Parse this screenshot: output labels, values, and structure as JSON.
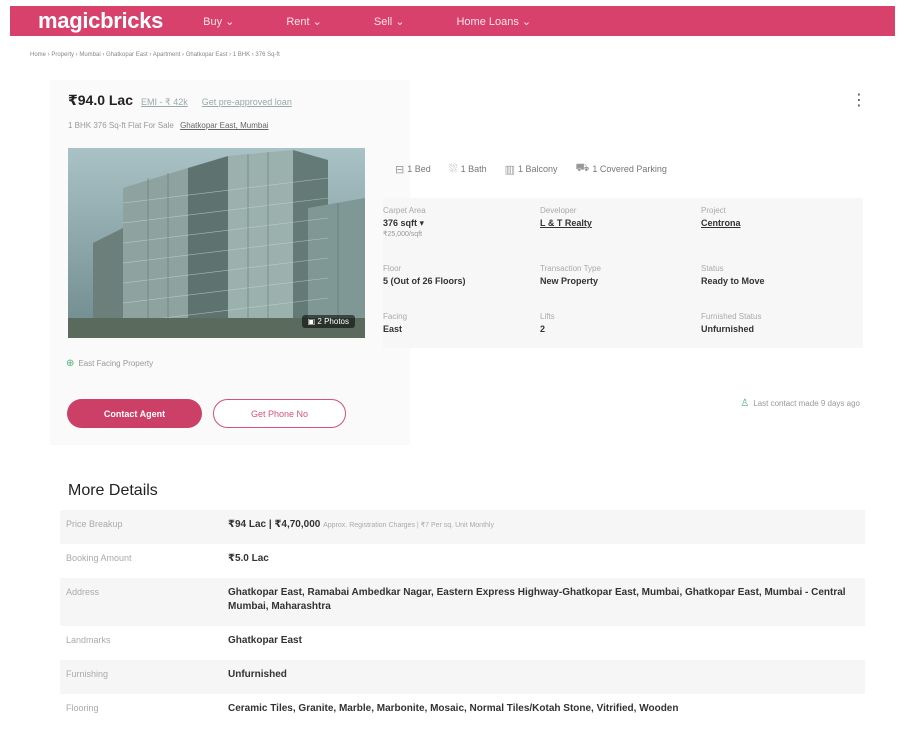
{
  "header": {
    "logo": "magicbricks",
    "nav": [
      "Buy ⌄",
      "Rent ⌄",
      "Sell ⌄",
      "Home Loans ⌄"
    ]
  },
  "breadcrumb": "Home › Property › Mumbai › Ghatkopar East › Apartment › Ghatkopar East › 1 BHK › 376 Sq-ft",
  "listing": {
    "price": "₹94.0 Lac",
    "emi": "EMI - ₹ 42k",
    "loan": "Get pre-approved loan",
    "subtitle": "1 BHK 376 Sq-ft Flat For Sale",
    "location": "Ghatkopar East, Mumbai",
    "photos_label": "2 Photos",
    "amenities": [
      "1 Bed",
      "1 Bath",
      "1 Balcony",
      "1 Covered Parking"
    ],
    "details": [
      {
        "label": "Carpet Area",
        "value": "376 sqft ▾",
        "sub": "₹25,000/sqft",
        "link": false
      },
      {
        "label": "Developer",
        "value": "L & T Realty",
        "sub": "",
        "link": true
      },
      {
        "label": "Project",
        "value": "Centrona",
        "sub": "",
        "link": true
      },
      {
        "label": "Floor",
        "value": "5 (Out of 26 Floors)",
        "sub": "",
        "link": false
      },
      {
        "label": "Transaction Type",
        "value": "New Property",
        "sub": "",
        "link": false
      },
      {
        "label": "Status",
        "value": "Ready to Move",
        "sub": "",
        "link": false
      },
      {
        "label": "Facing",
        "value": "East",
        "sub": "",
        "link": false
      },
      {
        "label": "Lifts",
        "value": "2",
        "sub": "",
        "link": false
      },
      {
        "label": "Furnished Status",
        "value": "Unfurnished",
        "sub": "",
        "link": false
      }
    ],
    "facing_note": "East Facing Property",
    "contact_button": "Contact Agent",
    "phone_button": "Get Phone No",
    "last_contact": "Last contact made 9 days ago"
  },
  "more_details": {
    "title": "More Details",
    "rows": [
      {
        "label": "Price Breakup",
        "value": "₹94 Lac | ₹4,70,000",
        "note": "Approx. Registration Charges | ₹7 Per sq. Unit Monthly"
      },
      {
        "label": "Booking Amount",
        "value": "₹5.0 Lac",
        "note": ""
      },
      {
        "label": "Address",
        "value": "Ghatkopar East, Ramabai Ambedkar Nagar, Eastern Express Highway-Ghatkopar East, Mumbai, Ghatkopar East, Mumbai - Central Mumbai, Maharashtra",
        "note": ""
      },
      {
        "label": "Landmarks",
        "value": "Ghatkopar East",
        "note": ""
      },
      {
        "label": "Furnishing",
        "value": "Unfurnished",
        "note": ""
      },
      {
        "label": "Flooring",
        "value": "Ceramic Tiles, Granite, Marble, Marbonite, Mosaic, Normal Tiles/Kotah Stone, Vitrified, Wooden",
        "note": ""
      }
    ]
  },
  "colors": {
    "brand": "#d8416b",
    "button": "#cc4067",
    "accent_green": "#4caf78"
  }
}
